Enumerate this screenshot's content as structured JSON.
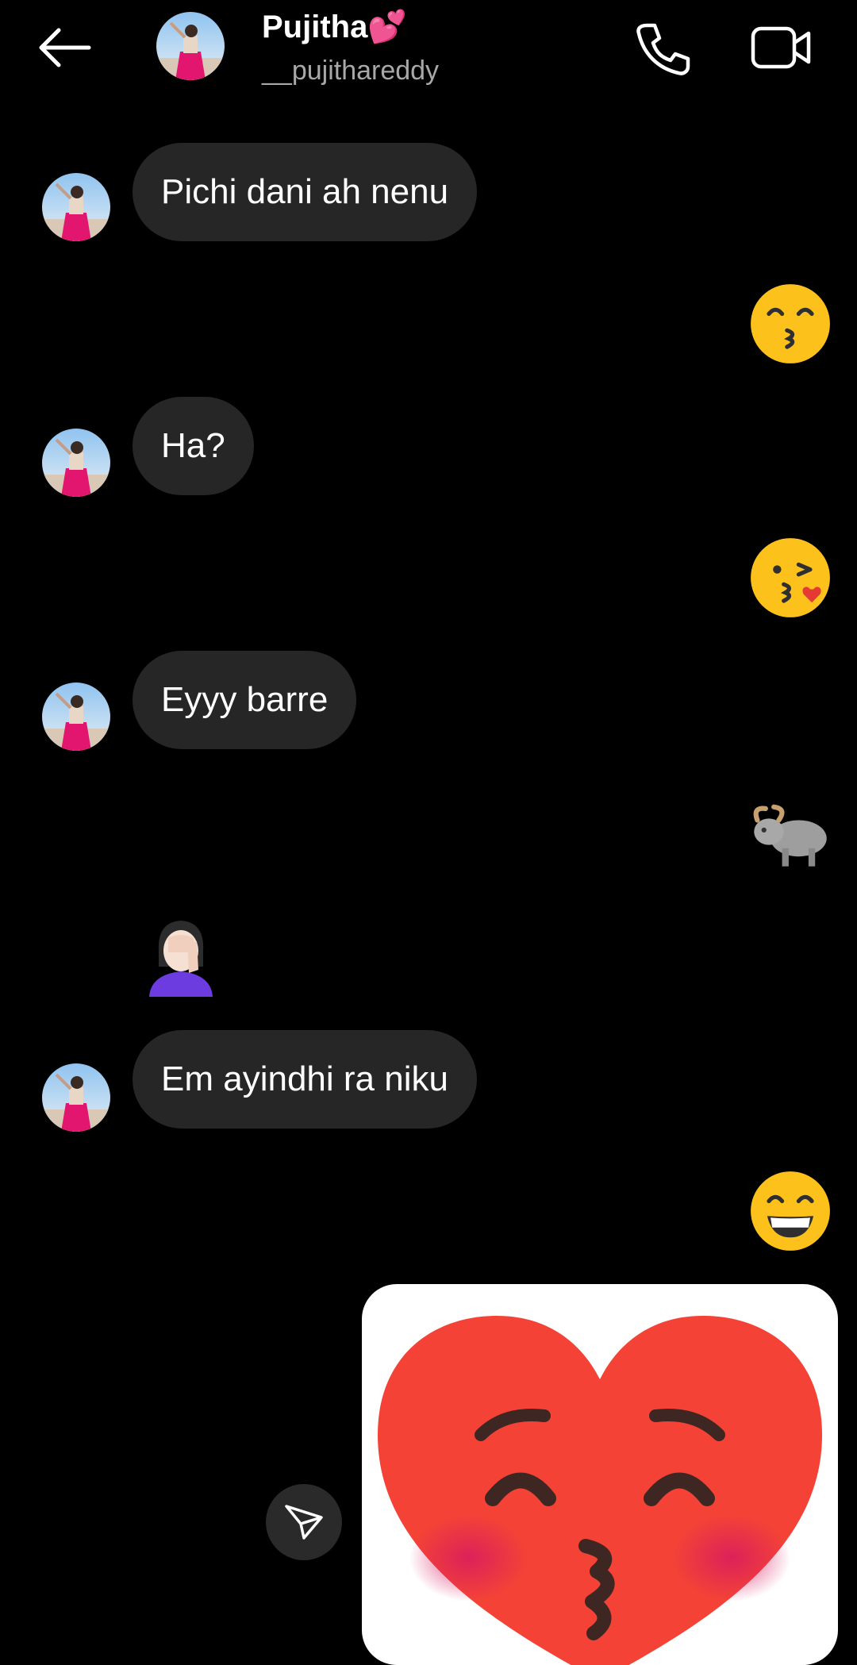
{
  "header": {
    "name": "Pujitha💕",
    "username": "__pujithareddy",
    "icons": {
      "back": "arrow-left-icon",
      "call": "phone-icon",
      "video": "video-camera-icon"
    }
  },
  "messages": [
    {
      "from": "them",
      "type": "text",
      "text": "Pichi dani ah nenu"
    },
    {
      "from": "me",
      "type": "emoji",
      "emoji": "kissing-smiling-eyes"
    },
    {
      "from": "them",
      "type": "text",
      "text": "Ha?"
    },
    {
      "from": "me",
      "type": "emoji",
      "emoji": "face-blowing-kiss"
    },
    {
      "from": "them",
      "type": "text",
      "text": "Eyyy barre"
    },
    {
      "from": "me",
      "type": "emoji",
      "emoji": "water-buffalo"
    },
    {
      "from": "them",
      "type": "emoji",
      "emoji": "woman-facepalming"
    },
    {
      "from": "them",
      "type": "text",
      "text": "Em ayindhi ra niku"
    },
    {
      "from": "me",
      "type": "emoji",
      "emoji": "beaming-face"
    },
    {
      "from": "me",
      "type": "sticker",
      "sticker": "kissing-heart-sticker"
    }
  ],
  "colors": {
    "background": "#000000",
    "bubble": "#262626",
    "text": "#ffffff",
    "muted": "#a8a8a8"
  }
}
